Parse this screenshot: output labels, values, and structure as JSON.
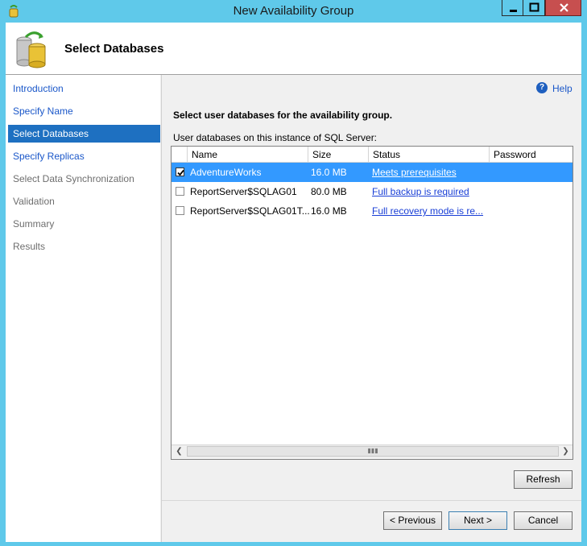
{
  "window": {
    "title": "New Availability Group",
    "minimize_icon": "minimize-icon",
    "maximize_icon": "maximize-icon",
    "close_icon": "close-icon"
  },
  "header": {
    "title": "Select Databases",
    "icon": "database-icon"
  },
  "nav": {
    "items": [
      {
        "label": "Introduction",
        "state": "link"
      },
      {
        "label": "Specify Name",
        "state": "link"
      },
      {
        "label": "Select Databases",
        "state": "selected"
      },
      {
        "label": "Specify Replicas",
        "state": "link"
      },
      {
        "label": "Select Data Synchronization",
        "state": "disabled"
      },
      {
        "label": "Validation",
        "state": "disabled"
      },
      {
        "label": "Summary",
        "state": "disabled"
      },
      {
        "label": "Results",
        "state": "disabled"
      }
    ]
  },
  "help": {
    "label": "Help",
    "icon": "help-icon"
  },
  "main": {
    "instruction": "Select user databases for the availability group.",
    "sublabel": "User databases on this instance of SQL Server:"
  },
  "grid": {
    "columns": [
      "Name",
      "Size",
      "Status",
      "Password"
    ],
    "rows": [
      {
        "checked": true,
        "name": "AdventureWorks",
        "size": "16.0 MB",
        "status": "Meets prerequisites",
        "selected": true
      },
      {
        "checked": false,
        "name": "ReportServer$SQLAG01",
        "size": "80.0 MB",
        "status": "Full backup is required",
        "selected": false
      },
      {
        "checked": false,
        "name": "ReportServer$SQLAG01T...",
        "size": "16.0 MB",
        "status": "Full recovery mode is re...",
        "selected": false
      }
    ]
  },
  "buttons": {
    "refresh": "Refresh",
    "previous": "< Previous",
    "next": "Next >",
    "cancel": "Cancel"
  },
  "colors": {
    "title_bar": "#5fc9ea",
    "selection": "#1e70c1",
    "link": "#1a57c9"
  }
}
